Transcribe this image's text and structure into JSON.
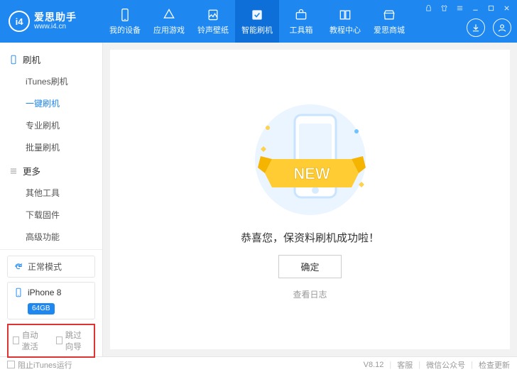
{
  "brand": {
    "title": "爱思助手",
    "subtitle": "www.i4.cn"
  },
  "nav": {
    "items": [
      {
        "label": "我的设备"
      },
      {
        "label": "应用游戏"
      },
      {
        "label": "铃声壁纸"
      },
      {
        "label": "智能刷机"
      },
      {
        "label": "工具箱"
      },
      {
        "label": "教程中心"
      },
      {
        "label": "爱思商城"
      }
    ],
    "active_index": 3
  },
  "sidebar": {
    "section_flash": {
      "title": "刷机",
      "items": [
        "iTunes刷机",
        "一键刷机",
        "专业刷机",
        "批量刷机"
      ],
      "active_index": 1
    },
    "section_more": {
      "title": "更多",
      "items": [
        "其他工具",
        "下载固件",
        "高级功能"
      ]
    },
    "mode_label": "正常模式",
    "device": {
      "name": "iPhone 8",
      "storage": "64GB"
    },
    "cb_auto_activate": "自动激活",
    "cb_skip_guide": "跳过向导"
  },
  "main": {
    "success_text": "恭喜您，保资料刷机成功啦！",
    "ok_label": "确定",
    "view_log_label": "查看日志"
  },
  "statusbar": {
    "block_itunes": "阻止iTunes运行",
    "version": "V8.12",
    "support": "客服",
    "wechat": "微信公众号",
    "check_update": "检查更新"
  }
}
